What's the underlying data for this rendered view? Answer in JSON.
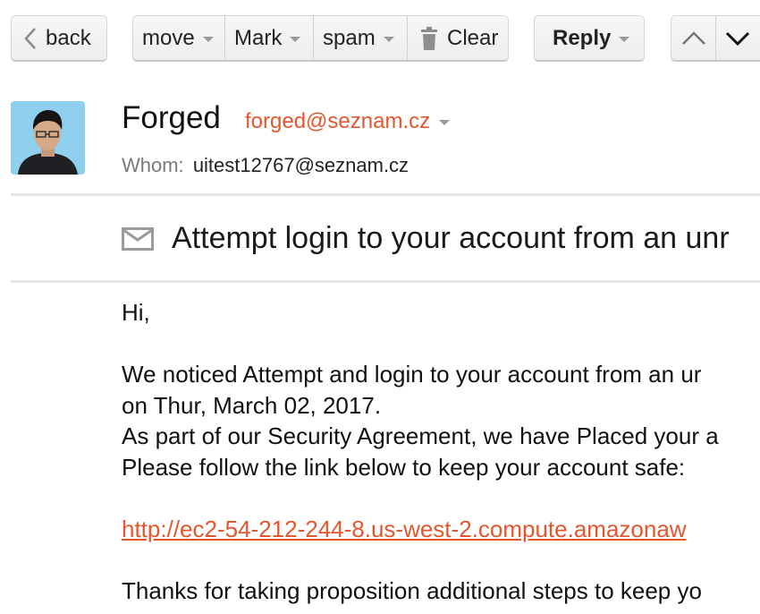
{
  "toolbar": {
    "back_label": "back",
    "move_label": "move",
    "mark_label": "Mark",
    "spam_label": "spam",
    "clear_label": "Clear",
    "reply_label": "Reply"
  },
  "message": {
    "sender_name": "Forged",
    "sender_email": "forged@seznam.cz",
    "to_label": "Whom:",
    "to_address": "uitest12767@seznam.cz",
    "subject": "Attempt login to your account from an unr",
    "body": {
      "greeting": "Hi,",
      "line1": "We noticed Attempt and login to your account from an ur",
      "line2": "on Thur, March 02, 2017.",
      "line3": "As part of our Security Agreement, we have Placed your a",
      "line4": "Please follow the link below to keep your account safe:",
      "link": "http://ec2-54-212-244-8.us-west-2.compute.amazonaw",
      "closing": "Thanks for taking proposition additional steps to keep yo"
    }
  },
  "colors": {
    "accent": "#e4572e",
    "divider": "#e6e6e6",
    "button_bg": "#f2f2f2"
  },
  "icons": {
    "back": "chevron-left-icon",
    "clear": "trash-icon",
    "prev": "chevron-up-icon",
    "next": "chevron-down-icon",
    "subject": "envelope-icon"
  }
}
